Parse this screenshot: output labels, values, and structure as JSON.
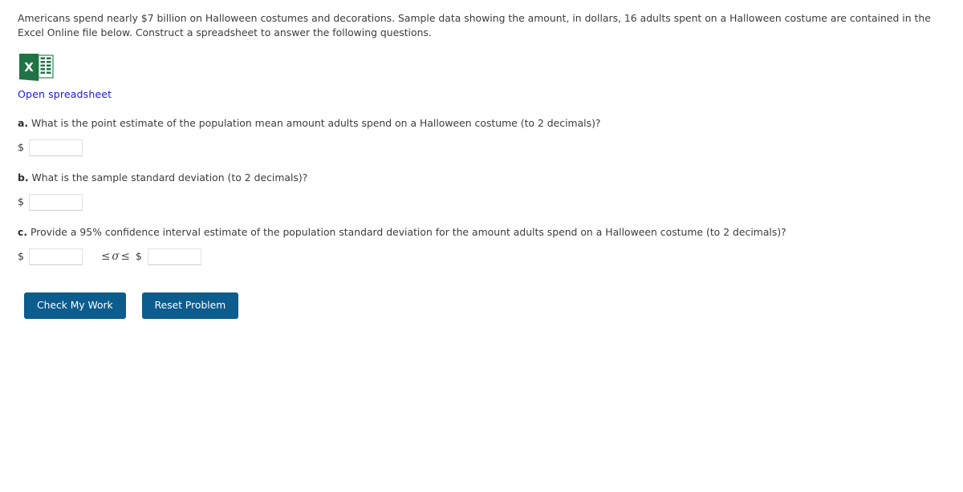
{
  "intro": {
    "text": "Americans spend nearly $7 billion on Halloween costumes and decorations. Sample data showing the amount, in dollars, 16 adults spent on a Halloween costume are contained in the Excel Online file below. Construct a spreadsheet to answer the following questions."
  },
  "spreadsheet": {
    "icon": "excel-file-icon",
    "link_label": "Open spreadsheet"
  },
  "questions": [
    {
      "letter": "a.",
      "text": "What is the point estimate of the population mean amount adults spend on a Halloween costume (to 2 decimals)?",
      "currency": "$",
      "value": "",
      "placeholder": ""
    },
    {
      "letter": "b.",
      "text": "What is the sample standard deviation (to 2 decimals)?",
      "currency": "$",
      "value": "",
      "placeholder": ""
    },
    {
      "letter": "c.",
      "text": "Provide a 95% confidence interval estimate of the population standard deviation for the amount adults spend on a Halloween costume (to 2 decimals)?",
      "currency": "$",
      "lower_value": "",
      "lower_placeholder": "",
      "inequality_left": "≤",
      "sigma": "σ",
      "inequality_right": "≤",
      "currency2": "$",
      "upper_value": "",
      "upper_placeholder": ""
    }
  ],
  "buttons": {
    "check_label": "Check My Work",
    "reset_label": "Reset Problem",
    "color": "#0d5c8e"
  },
  "colors": {
    "link": "#1a18e8",
    "text": "#3c3c3c",
    "excel_green": "#217346",
    "excel_dark_green": "#1d6b41"
  }
}
